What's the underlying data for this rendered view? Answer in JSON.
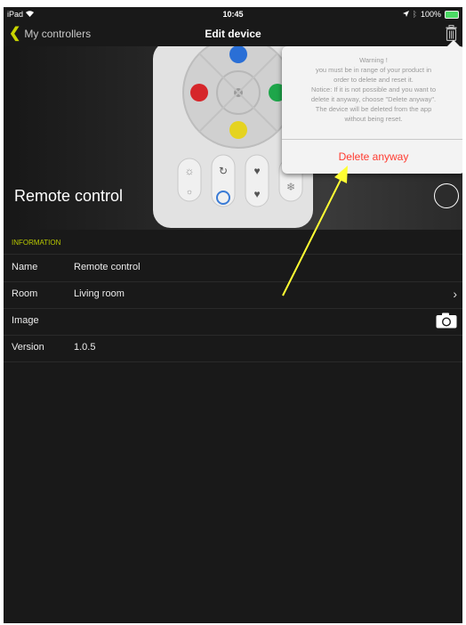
{
  "status_bar": {
    "device": "iPad",
    "time": "10:45",
    "battery": "100%"
  },
  "nav": {
    "back_label": "My controllers",
    "title": "Edit device"
  },
  "hero": {
    "device_name": "Remote control"
  },
  "popover": {
    "message": "Warning !\nyou must be in range of your product in\norder to delete and reset it.\nNotice: If it is not possible and you want to\ndelete it anyway, choose \"Delete anyway\".\nThe device will be deleted from the app\nwithout being reset.",
    "delete_label": "Delete anyway"
  },
  "info": {
    "section_label": "INFORMATION",
    "rows": [
      {
        "label": "Name",
        "value": "Remote control"
      },
      {
        "label": "Room",
        "value": "Living room"
      },
      {
        "label": "Image",
        "value": ""
      },
      {
        "label": "Version",
        "value": "1.0.5"
      }
    ]
  },
  "colors": {
    "accent": "#c8d400",
    "destructive": "#ff3b30",
    "annotation_arrow": "#ffff33"
  },
  "icons": [
    "wifi-icon",
    "location-icon",
    "bluetooth-icon",
    "battery-icon",
    "chevron-left-icon",
    "trash-icon",
    "chevron-right-icon",
    "camera-icon"
  ]
}
